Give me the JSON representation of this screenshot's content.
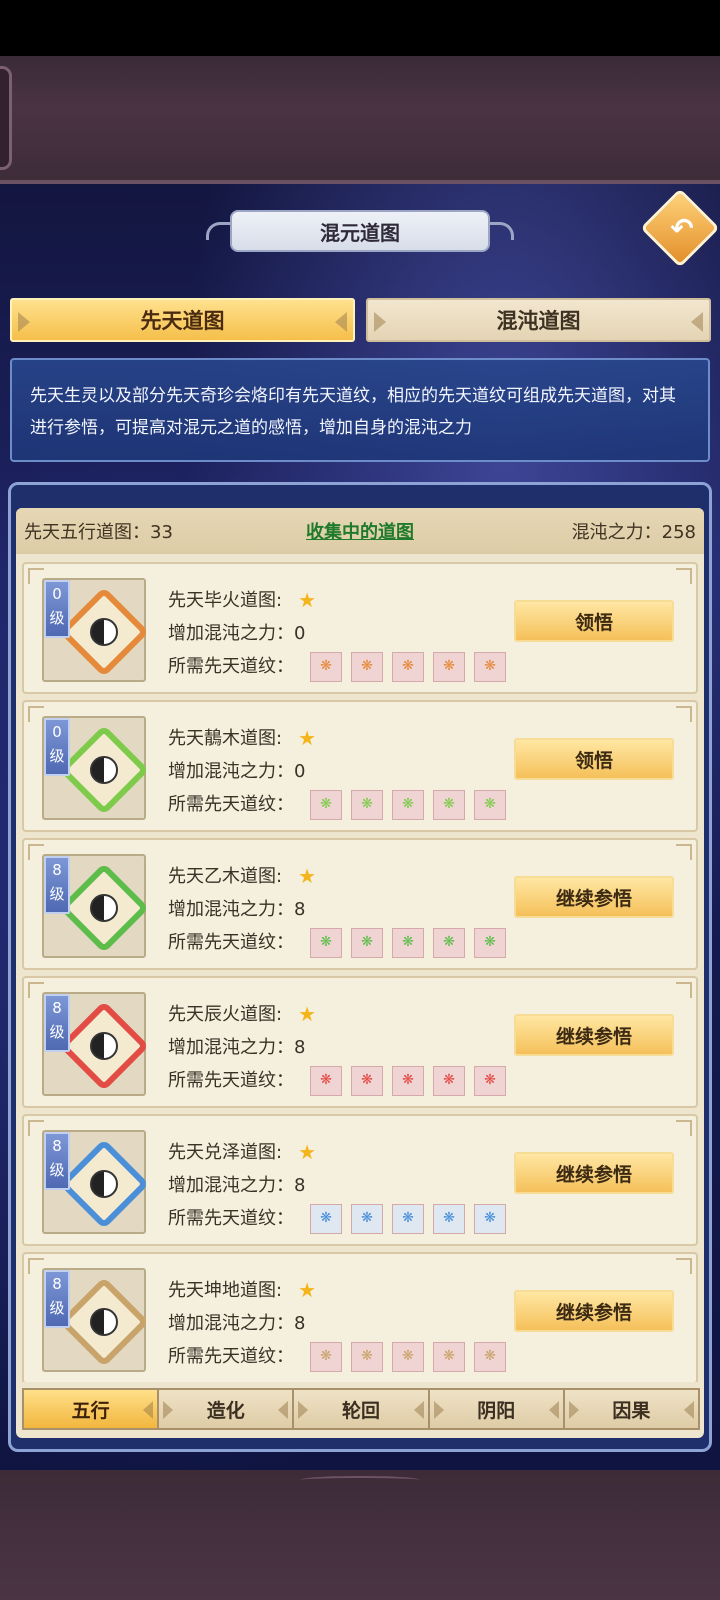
{
  "window": {
    "title": "混元道图"
  },
  "tabs": [
    {
      "label": "先天道图",
      "active": true
    },
    {
      "label": "混沌道图",
      "active": false
    }
  ],
  "description": "先天生灵以及部分先天奇珍会烙印有先天道纹，相应的先天道纹可组成先天道图，对其进行参悟，可提高对混元之道的感悟，增加自身的混沌之力",
  "stats": {
    "collection_label": "先天五行道图：33",
    "collecting_label": "收集中的道图",
    "power_label": "混沌之力：258"
  },
  "labels": {
    "add_power": "增加混沌之力：",
    "required_runes": "所需先天道纹："
  },
  "cards": [
    {
      "level_num": "0",
      "level_unit": "级",
      "name": "先天毕火道图:",
      "power": "0",
      "button": "领悟",
      "color": "#e58a3a",
      "rune_color": "#f0d4d4"
    },
    {
      "level_num": "0",
      "level_unit": "级",
      "name": "先天鶄木道图:",
      "power": "0",
      "button": "领悟",
      "color": "#7ecb4b",
      "rune_color": "#f0d4d4"
    },
    {
      "level_num": "8",
      "level_unit": "级",
      "name": "先天乙木道图:",
      "power": "8",
      "button": "继续参悟",
      "color": "#5ebd4a",
      "rune_color": "#f0d4d4"
    },
    {
      "level_num": "8",
      "level_unit": "级",
      "name": "先天辰火道图:",
      "power": "8",
      "button": "继续参悟",
      "color": "#e34b45",
      "rune_color": "#f0d4d4"
    },
    {
      "level_num": "8",
      "level_unit": "级",
      "name": "先天兑泽道图:",
      "power": "8",
      "button": "继续参悟",
      "color": "#4a8fd8",
      "rune_color": "#dfe8f0"
    },
    {
      "level_num": "8",
      "level_unit": "级",
      "name": "先天坤地道图:",
      "power": "8",
      "button": "继续参悟",
      "color": "#c9a46a",
      "rune_color": "#f0d4d4"
    }
  ],
  "categories": [
    {
      "label": "五行",
      "active": true
    },
    {
      "label": "造化",
      "active": false
    },
    {
      "label": "轮回",
      "active": false
    },
    {
      "label": "阴阳",
      "active": false
    },
    {
      "label": "因果",
      "active": false
    }
  ],
  "icons": {
    "back": "back-arrow-icon",
    "star": "star-icon",
    "rune": "rune-icon"
  }
}
